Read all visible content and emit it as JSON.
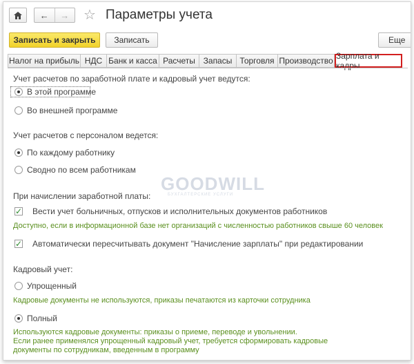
{
  "header": {
    "title": "Параметры учета",
    "home_icon": "home-icon",
    "back_glyph": "←",
    "forward_glyph": "→",
    "star_glyph": "☆"
  },
  "toolbar": {
    "save_close_label": "Записать и закрыть",
    "save_label": "Записать",
    "more_label": "Еще"
  },
  "tabs": [
    {
      "label": "Налог на прибыль"
    },
    {
      "label": "НДС"
    },
    {
      "label": "Банк и касса"
    },
    {
      "label": "Расчеты"
    },
    {
      "label": "Запасы"
    },
    {
      "label": "Торговля"
    },
    {
      "label": "Производство"
    },
    {
      "label": "Зарплата и кадры",
      "active": true
    }
  ],
  "payroll": {
    "heading": "Учет расчетов по заработной плате и кадровый учет ведутся:",
    "options": [
      "В этой программе",
      "Во внешней программе"
    ],
    "selected": 0
  },
  "personnel_settlements": {
    "heading": "Учет расчетов с персоналом ведется:",
    "options": [
      "По каждому работнику",
      "Сводно по всем работникам"
    ],
    "selected": 0
  },
  "accrual": {
    "heading": "При начислении заработной платы:",
    "check1": "Вести учет больничных, отпусков и исполнительных документов работников",
    "check1_hint": "Доступно, если в информационной базе нет организаций с численностью работников свыше 60 человек",
    "check2": "Автоматически пересчитывать документ \"Начисление зарплаты\" при редактировании"
  },
  "hr": {
    "heading": "Кадровый учет:",
    "option_simple": "Упрощенный",
    "option_simple_hint": "Кадровые документы не используются, приказы печатаются из карточки сотрудника",
    "option_full": "Полный",
    "option_full_hint1": "Используются кадровые документы: приказы о приеме, переводе и увольнении.",
    "option_full_hint2": "Если ранее применялся упрощенный кадровый учет, требуется сформировать кадровые",
    "option_full_hint3": "документы по сотрудникам, введенным в программу",
    "selected": "full"
  },
  "watermark": {
    "text": "GOODWILL",
    "subtext": "БУХГАЛТЕРСКИЕ УСЛУГИ"
  }
}
